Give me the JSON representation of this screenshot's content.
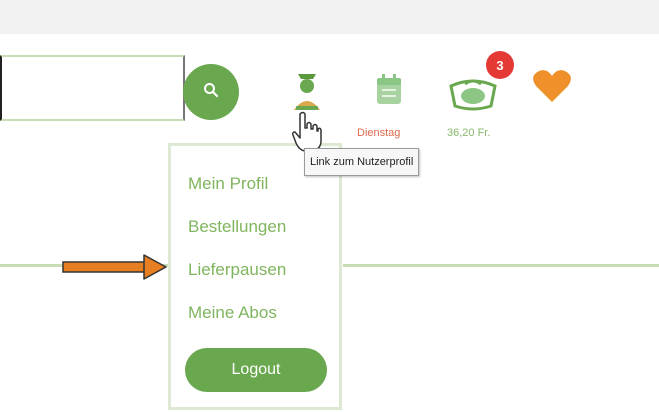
{
  "header": {
    "search": {
      "placeholder": "",
      "value": ""
    },
    "icons": {
      "search": "search-icon",
      "user": "user-icon",
      "calendar": "calendar-icon",
      "cart": "cart-icon",
      "heart": "heart-icon"
    },
    "delivery_day": "Dienstag",
    "cart_total": "36,20 Fr.",
    "cart_badge": "3"
  },
  "tooltip": {
    "text": "Link zum Nutzerprofil"
  },
  "user_menu": {
    "items": [
      {
        "label": "Mein Profil"
      },
      {
        "label": "Bestellungen"
      },
      {
        "label": "Lieferpausen"
      },
      {
        "label": "Meine Abos"
      }
    ],
    "logout_label": "Logout"
  },
  "colors": {
    "brand_green": "#6aa84f",
    "menu_text": "#7fb55e",
    "badge_red": "#e53935",
    "heart_orange": "#f0902a",
    "annotation_arrow": "#e67e22"
  }
}
